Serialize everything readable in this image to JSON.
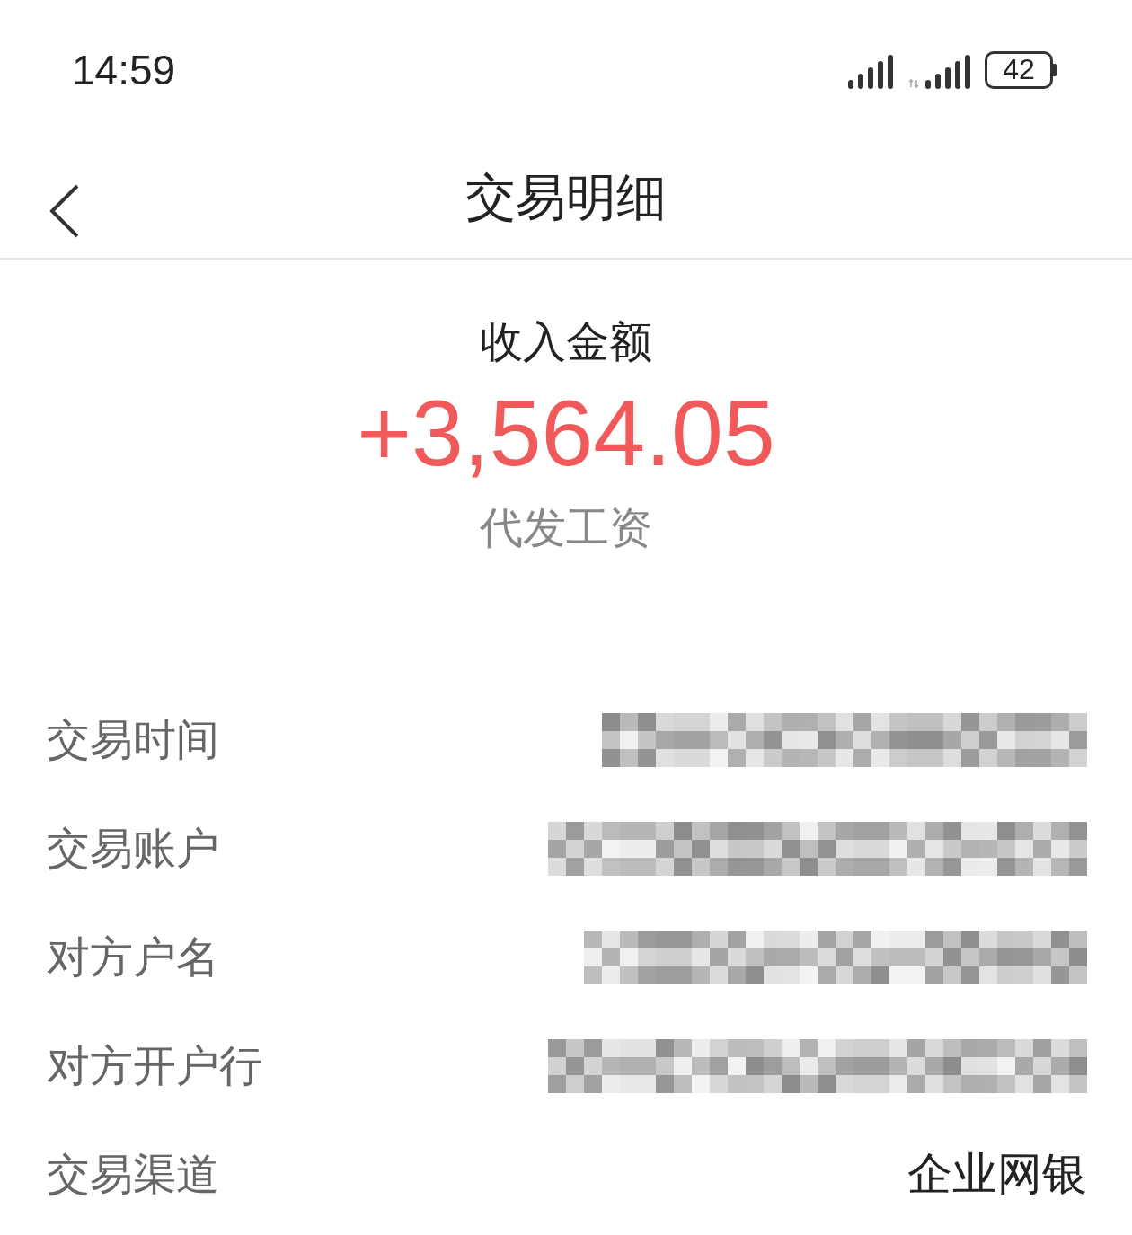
{
  "status_bar": {
    "time": "14:59",
    "battery": "42"
  },
  "header": {
    "title": "交易明细"
  },
  "summary": {
    "label": "收入金额",
    "amount": "+3,564.05",
    "type": "代发工资"
  },
  "details": [
    {
      "label": "交易时间",
      "kind": "redacted"
    },
    {
      "label": "交易账户",
      "kind": "redacted"
    },
    {
      "label": "对方户名",
      "kind": "redacted"
    },
    {
      "label": "对方开户行",
      "kind": "redacted"
    },
    {
      "label": "交易渠道",
      "kind": "text",
      "value": "企业网银"
    }
  ]
}
